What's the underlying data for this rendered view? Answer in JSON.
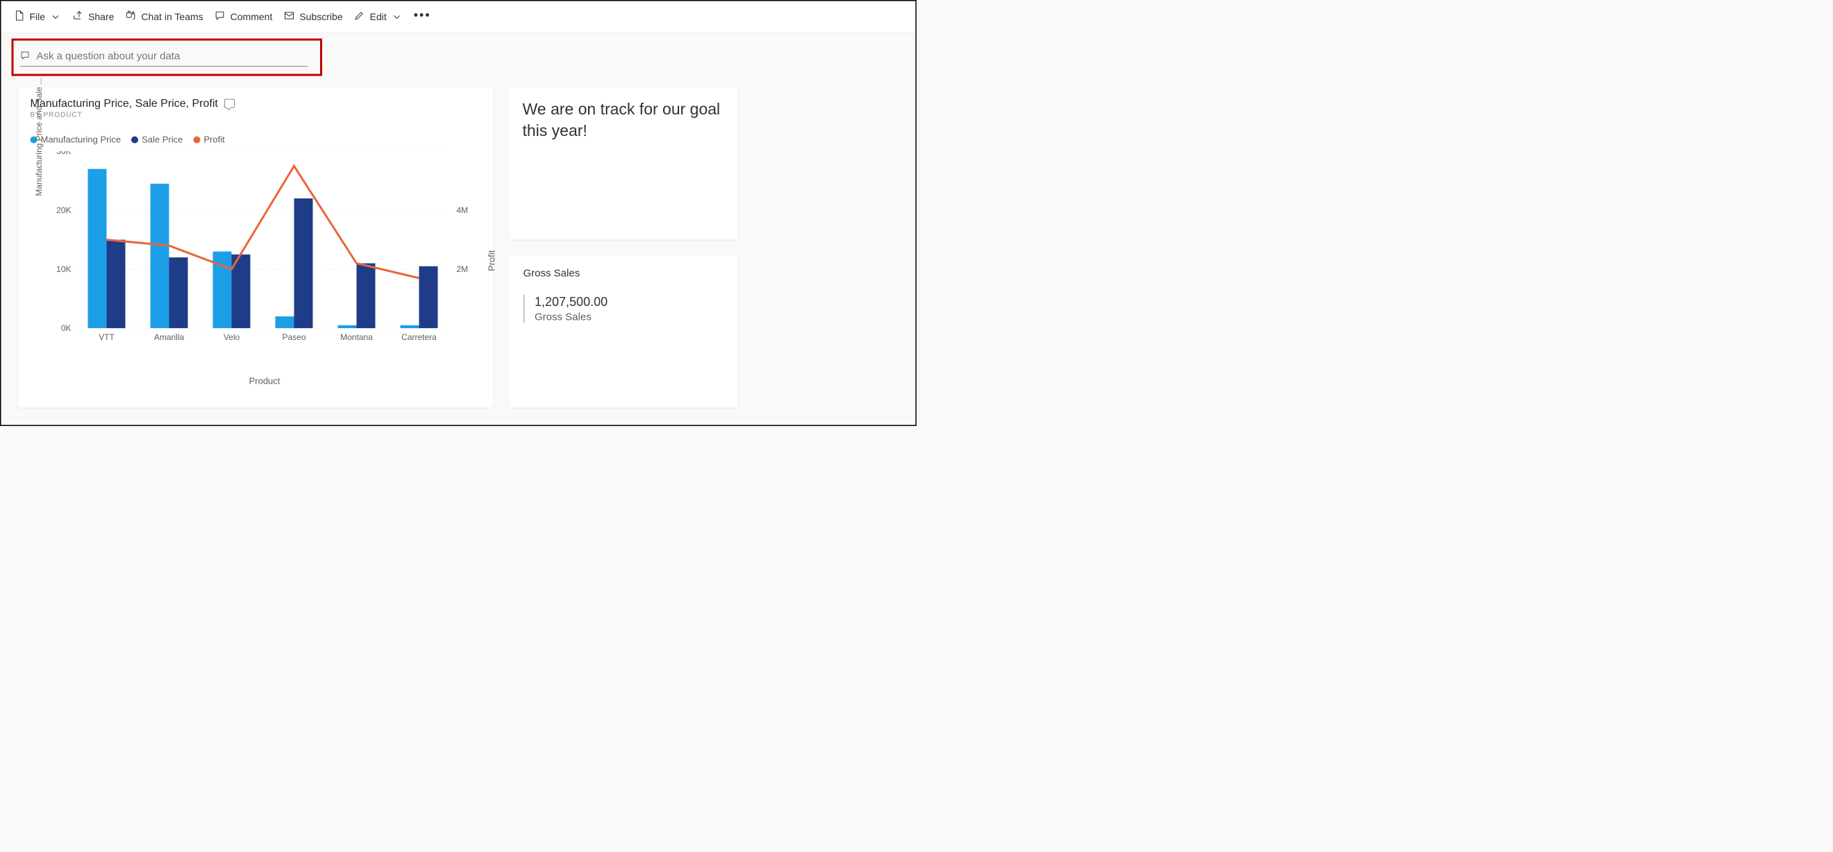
{
  "toolbar": {
    "file": "File",
    "share": "Share",
    "chat_in_teams": "Chat in Teams",
    "comment": "Comment",
    "subscribe": "Subscribe",
    "edit": "Edit"
  },
  "qna": {
    "placeholder": "Ask a question about your data"
  },
  "chart_tile": {
    "title": "Manufacturing Price, Sale Price, Profit",
    "subtitle": "BY PRODUCT",
    "legend": [
      "Manufacturing Price",
      "Sale Price",
      "Profit"
    ],
    "xlabel": "Product",
    "ylabel_left": "Manufacturing Price and Sale ...",
    "ylabel_right": "Profit"
  },
  "chart_data": {
    "type": "bar",
    "categories": [
      "VTT",
      "Amarilla",
      "Velo",
      "Paseo",
      "Montana",
      "Carretera"
    ],
    "series": [
      {
        "name": "Manufacturing Price",
        "type": "bar",
        "axis": "left",
        "color": "#1f9ee8",
        "values": [
          27000,
          24500,
          13000,
          2000,
          500,
          500
        ]
      },
      {
        "name": "Sale Price",
        "type": "bar",
        "axis": "left",
        "color": "#1f3c88",
        "values": [
          15000,
          12000,
          12500,
          22000,
          11000,
          10500
        ]
      },
      {
        "name": "Profit",
        "type": "line",
        "axis": "right",
        "color": "#e8653b",
        "values": [
          3000000,
          2800000,
          2000000,
          5500000,
          2200000,
          1700000
        ]
      }
    ],
    "yaxis_left": {
      "min": 0,
      "max": 30000,
      "ticks": [
        "0K",
        "10K",
        "20K",
        "30K"
      ]
    },
    "yaxis_right": {
      "min": 0,
      "max": 6000000,
      "ticks": [
        "2M",
        "4M"
      ]
    },
    "xlabel": "Product",
    "ylabel_left": "Manufacturing Price and Sale ...",
    "ylabel_right": "Profit"
  },
  "text_tile": {
    "body": "We are on track for our goal this year!"
  },
  "metric_tile": {
    "title": "Gross Sales",
    "value": "1,207,500.00",
    "label": "Gross Sales"
  },
  "colors": {
    "mfg": "#1f9ee8",
    "sale": "#1f3c88",
    "profit": "#e8653b"
  }
}
